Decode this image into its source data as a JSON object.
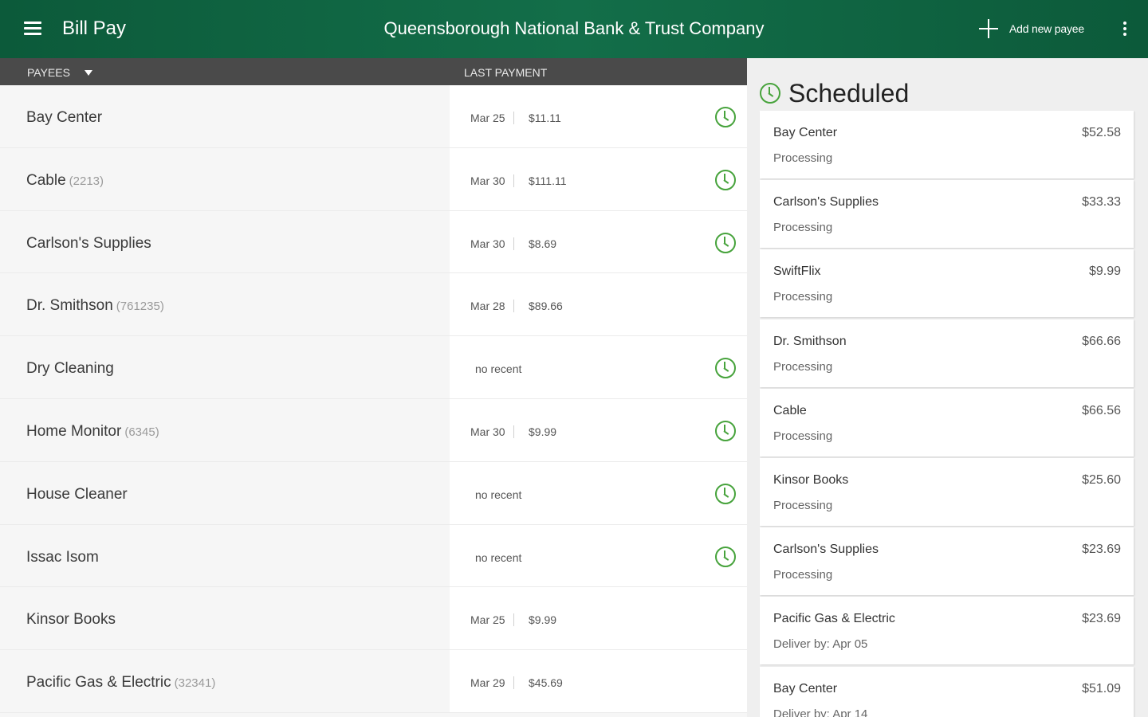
{
  "appbar": {
    "title": "Bill Pay",
    "bank_name": "Queensborough National Bank & Trust Company",
    "add_payee_label": "Add new payee",
    "icons": {
      "menu": "hamburger-menu-icon",
      "add": "plus-icon",
      "more": "more-vertical-icon"
    }
  },
  "colors": {
    "appbar": "#0c5a3a",
    "accent": "#47a33c",
    "header_bar": "#4a4a4a"
  },
  "payees_header": {
    "payees_label": "PAYEES",
    "last_payment_label": "LAST PAYMENT"
  },
  "payees": [
    {
      "name": "Bay Center",
      "account": "",
      "date": "Mar 25",
      "amount": "$11.11",
      "no_recent": "",
      "scheduled": true
    },
    {
      "name": "Cable",
      "account": "(2213)",
      "date": "Mar 30",
      "amount": "$111.11",
      "no_recent": "",
      "scheduled": true
    },
    {
      "name": "Carlson's Supplies",
      "account": "",
      "date": "Mar 30",
      "amount": "$8.69",
      "no_recent": "",
      "scheduled": true
    },
    {
      "name": "Dr. Smithson",
      "account": "(761235)",
      "date": "Mar 28",
      "amount": "$89.66",
      "no_recent": "",
      "scheduled": false
    },
    {
      "name": "Dry Cleaning",
      "account": "",
      "date": "",
      "amount": "",
      "no_recent": "no recent",
      "scheduled": true
    },
    {
      "name": "Home Monitor",
      "account": "(6345)",
      "date": "Mar 30",
      "amount": "$9.99",
      "no_recent": "",
      "scheduled": true
    },
    {
      "name": "House Cleaner",
      "account": "",
      "date": "",
      "amount": "",
      "no_recent": "no recent",
      "scheduled": true
    },
    {
      "name": "Issac Isom",
      "account": "",
      "date": "",
      "amount": "",
      "no_recent": "no recent",
      "scheduled": true
    },
    {
      "name": "Kinsor Books",
      "account": "",
      "date": "Mar 25",
      "amount": "$9.99",
      "no_recent": "",
      "scheduled": false
    },
    {
      "name": "Pacific Gas & Electric",
      "account": "(32341)",
      "date": "Mar 29",
      "amount": "$45.69",
      "no_recent": "",
      "scheduled": false
    }
  ],
  "scheduled": {
    "title": "Scheduled",
    "items": [
      {
        "name": "Bay Center",
        "amount": "$52.58",
        "status": "Processing"
      },
      {
        "name": "Carlson's Supplies",
        "amount": "$33.33",
        "status": "Processing"
      },
      {
        "name": "SwiftFlix",
        "amount": "$9.99",
        "status": "Processing"
      },
      {
        "name": "Dr. Smithson",
        "amount": "$66.66",
        "status": "Processing"
      },
      {
        "name": "Cable",
        "amount": "$66.56",
        "status": "Processing"
      },
      {
        "name": "Kinsor Books",
        "amount": "$25.60",
        "status": "Processing"
      },
      {
        "name": "Carlson's Supplies",
        "amount": "$23.69",
        "status": "Processing"
      },
      {
        "name": "Pacific Gas & Electric",
        "amount": "$23.69",
        "status": "Deliver by: Apr 05"
      },
      {
        "name": "Bay Center",
        "amount": "$51.09",
        "status": "Deliver by: Apr 14"
      }
    ]
  }
}
